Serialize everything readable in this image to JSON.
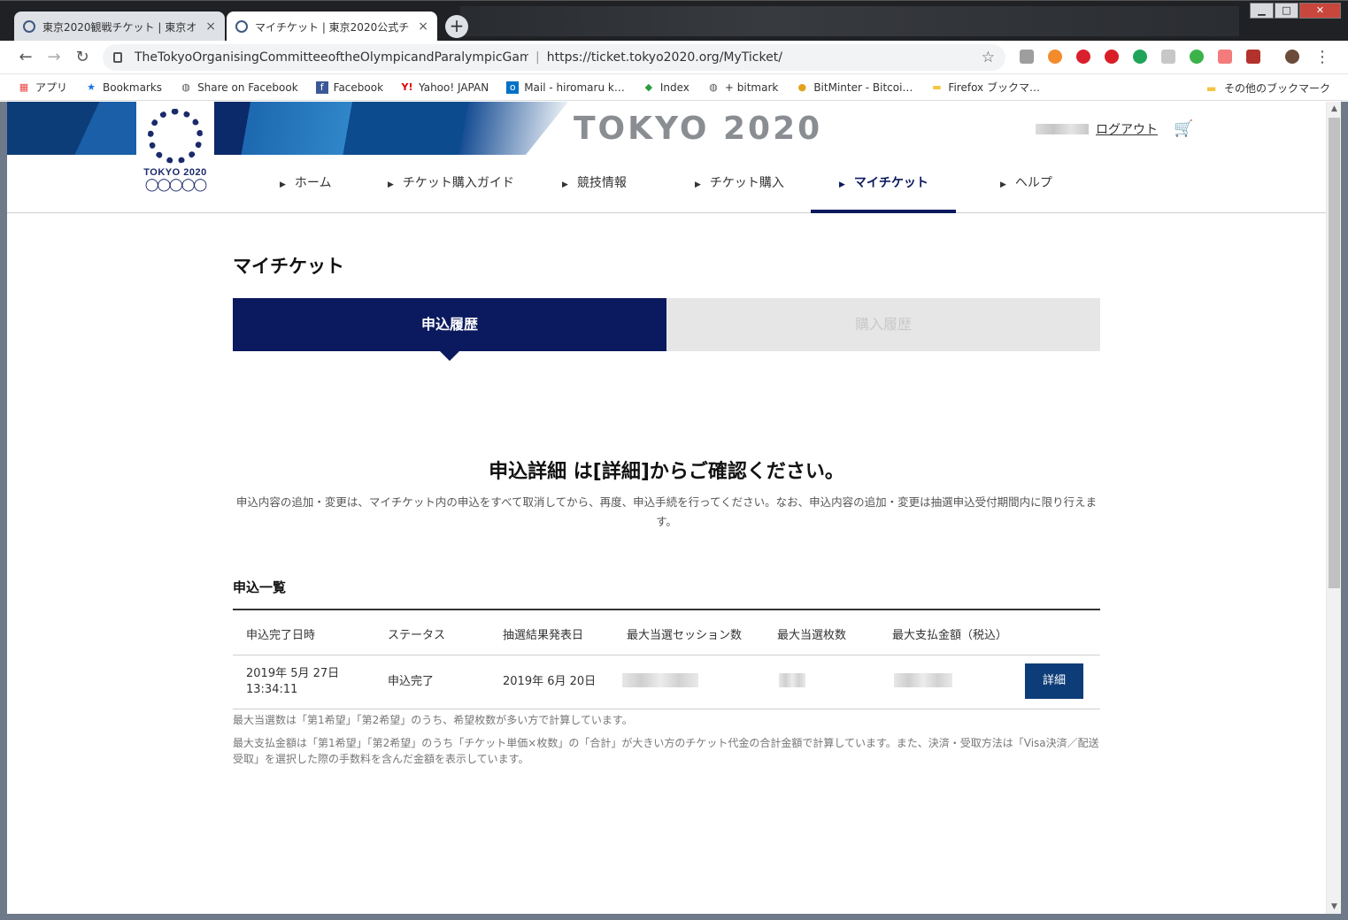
{
  "browser": {
    "tabs": [
      {
        "title": "東京2020観戦チケット | 東京オ",
        "close": "×"
      },
      {
        "title": "マイチケット | 東京2020公式チ",
        "close": "×"
      }
    ],
    "new_tab": "+",
    "window_buttons": {
      "minimize": "▁",
      "maximize": "□",
      "close": "✕"
    },
    "nav": {
      "back": "←",
      "forward": "→",
      "reload": "↻"
    },
    "omnibox": {
      "org": "TheTokyoOrganisingCommitteeoftheOlympicandParalympicGames",
      "url": "https://ticket.tokyo2020.org/MyTicket/",
      "star": "☆"
    },
    "menu": "⋮",
    "bookmarks": [
      {
        "label": "アプリ",
        "icon": "apps-icon"
      },
      {
        "label": "Bookmarks",
        "icon": "star-icon"
      },
      {
        "label": "Share on Facebook",
        "icon": "globe-icon"
      },
      {
        "label": "Facebook",
        "icon": "facebook-icon"
      },
      {
        "label": "Yahoo! JAPAN",
        "icon": "yahoo-icon"
      },
      {
        "label": "Mail - hiromaru k…",
        "icon": "outlook-icon"
      },
      {
        "label": "Index",
        "icon": "diamond-icon"
      },
      {
        "label": "+ bitmark",
        "icon": "globe-icon"
      },
      {
        "label": "BitMinter - Bitcoi…",
        "icon": "bitcoin-icon"
      },
      {
        "label": "Firefox ブックマ…",
        "icon": "folder-icon"
      }
    ],
    "bookmarks_other": "その他のブックマーク"
  },
  "site": {
    "brand": "TOKYO 2020",
    "emblem_word": "TOKYO 2020",
    "logout": "ログアウト",
    "cart": "🛒",
    "nav": [
      {
        "label": "ホーム"
      },
      {
        "label": "チケット購入ガイド"
      },
      {
        "label": "競技情報"
      },
      {
        "label": "チケット購入"
      },
      {
        "label": "マイチケット"
      },
      {
        "label": "ヘルプ"
      }
    ]
  },
  "main": {
    "title": "マイチケット",
    "tab_active": "申込履歴",
    "tab_inactive": "購入履歴",
    "headline": "申込詳細 は[詳細]からご確認ください。",
    "note": "申込内容の追加・変更は、マイチケット内の申込をすべて取消してから、再度、申込手続を行ってください。なお、申込内容の追加・変更は抽選申込受付期間内に限り行えます。",
    "list_title": "申込一覧",
    "table": {
      "headers": [
        "申込完了日時",
        "ステータス",
        "抽選結果発表日",
        "最大当選セッション数",
        "最大当選枚数",
        "最大支払金額（税込）"
      ],
      "row": {
        "date": "2019年 5月 27日",
        "time": "13:34:11",
        "status": "申込完了",
        "result_date": "2019年 6月 20日",
        "detail_button": "詳細"
      }
    },
    "footnote1": "最大当選数は「第1希望」「第2希望」のうち、希望枚数が多い方で計算しています。",
    "footnote2": "最大支払金額は「第1希望」「第2希望」のうち「チケット単価×枚数」の「合計」が大きい方のチケット代金の合計金額で計算しています。また、決済・受取方法は「Visa決済／配送受取」を選択した際の手数料を含んだ金額を表示しています。"
  },
  "colors": {
    "navy": "#0b1a5e",
    "button": "#0d3d78",
    "link": "#1a5b9a"
  }
}
